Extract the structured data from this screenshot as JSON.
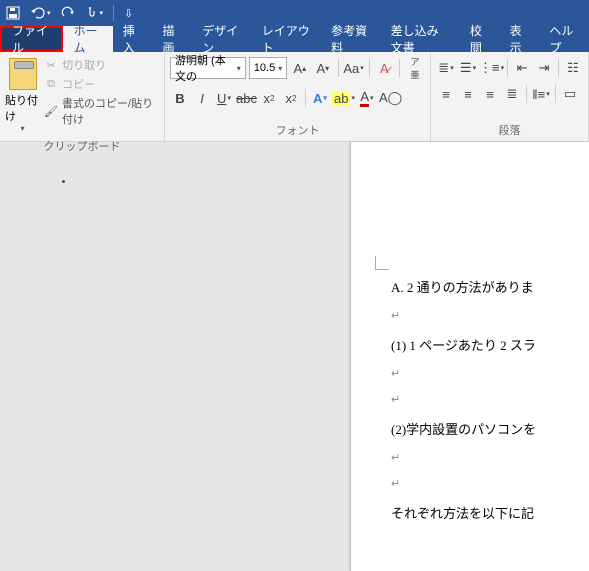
{
  "titlebar": {
    "icons": [
      "save-icon",
      "undo-icon",
      "redo-icon",
      "touch-icon"
    ]
  },
  "tabs": {
    "file": "ファイル",
    "home": "ホーム",
    "insert": "挿入",
    "draw": "描画",
    "design": "デザイン",
    "layout": "レイアウト",
    "references": "参考資料",
    "mailings": "差し込み文書",
    "review": "校閲",
    "view": "表示",
    "help": "ヘルプ"
  },
  "ribbon": {
    "clipboard": {
      "paste": "貼り付け",
      "cut": "切り取り",
      "copy": "コピー",
      "formatPainter": "書式のコピー/貼り付け",
      "label": "クリップボード"
    },
    "font": {
      "fontName": "游明朝 (本文の",
      "fontSize": "10.5",
      "label": "フォント"
    },
    "paragraph": {
      "label": "段落"
    }
  },
  "document": {
    "lines": [
      "A. 2 通りの方法がありま",
      "↵",
      "(1) 1 ページあたり 2 スラ",
      "↵",
      "↵",
      "(2)学内設置のパソコンを",
      "↵",
      "↵",
      "それぞれ方法を以下に記"
    ]
  }
}
